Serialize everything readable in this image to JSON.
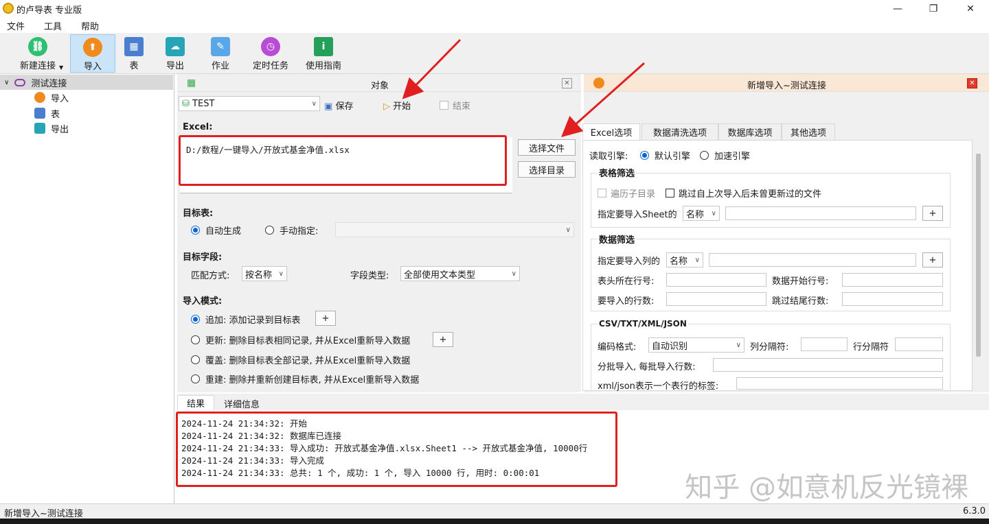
{
  "window": {
    "title": "的卢导表 专业版",
    "controls": [
      "—",
      "❐",
      "✕"
    ]
  },
  "menu": [
    "文件",
    "工具",
    "帮助"
  ],
  "toolbar": [
    {
      "label": "新建连接",
      "icon": "link-icon",
      "color": "#2fbf71"
    },
    {
      "label": "导入",
      "icon": "import-icon",
      "color": "#f08a1c"
    },
    {
      "label": "表",
      "icon": "table-icon",
      "color": "#4a7fd0"
    },
    {
      "label": "导出",
      "icon": "export-icon",
      "color": "#25a5b5"
    },
    {
      "label": "作业",
      "icon": "job-icon",
      "color": "#5aa7e8"
    },
    {
      "label": "定时任务",
      "icon": "timer-icon",
      "color": "#b84cd6"
    },
    {
      "label": "使用指南",
      "icon": "guide-icon",
      "color": "#25a05a"
    }
  ],
  "tree": {
    "root": "测试连接",
    "children": [
      "导入",
      "表",
      "导出"
    ]
  },
  "object_panel": {
    "title": "对象",
    "db_select": "TEST",
    "save": "保存",
    "start": "开始",
    "end": "结束",
    "excel_label": "Excel:",
    "excel_path": "D:/数程/一键导入/开放式基金净值.xlsx",
    "choose_file": "选择文件",
    "choose_dir": "选择目录",
    "target_table_label": "目标表:",
    "auto_gen": "自动生成",
    "manual": "手动指定:",
    "target_field_label": "目标字段:",
    "match_label": "匹配方式:",
    "match_value": "按名称",
    "field_type_label": "字段类型:",
    "field_type_value": "全部使用文本类型",
    "import_mode_label": "导入模式:",
    "modes": [
      "追加: 添加记录到目标表",
      "更新: 删除目标表相同记录, 并从Excel重新导入数据",
      "覆盖: 删除目标表全部记录, 并从Excel重新导入数据",
      "重建: 删除并重新创建目标表, 并从Excel重新导入数据"
    ],
    "plus": "+"
  },
  "right_panel": {
    "title": "新增导入~测试连接",
    "tabs": [
      "Excel选项",
      "数据清洗选项",
      "数据库选项",
      "其他选项"
    ],
    "engine_label": "读取引擎:",
    "engine_default": "默认引擎",
    "engine_fast": "加速引擎",
    "sheet_filter": "表格筛选",
    "traverse": "遍历子目录",
    "skip_unchanged": "跳过自上次导入后未曾更新过的文件",
    "sheet_label": "指定要导入Sheet的",
    "name": "名称",
    "data_filter": "数据筛选",
    "cols_label": "指定要导入列的",
    "header_row": "表头所在行号:",
    "data_start": "数据开始行号:",
    "rows_count": "要导入的行数:",
    "skip_tail": "跳过结尾行数:",
    "csv_group": "CSV/TXT/XML/JSON",
    "encoding_label": "编码格式:",
    "encoding_value": "自动识别",
    "col_sep": "列分隔符:",
    "row_sep": "行分隔符",
    "batch": "分批导入, 每批导入行数:",
    "xml_tag": "xml/json表示一个表行的标签:"
  },
  "results": {
    "tabs": [
      "结果",
      "详细信息"
    ],
    "log": [
      "2024-11-24 21:34:32: 开始",
      "2024-11-24 21:34:32: 数据库已连接",
      "2024-11-24 21:34:33: 导入成功: 开放式基金净值.xlsx.Sheet1 --> 开放式基金净值, 10000行",
      "2024-11-24 21:34:33: 导入完成",
      "2024-11-24 21:34:33: 总共: 1 个, 成功: 1 个, 导入 10000 行, 用时: 0:00:01"
    ]
  },
  "status": {
    "left": "新增导入~测试连接",
    "version": "6.3.0"
  },
  "watermark": "知乎 @如意机反光镜裸"
}
